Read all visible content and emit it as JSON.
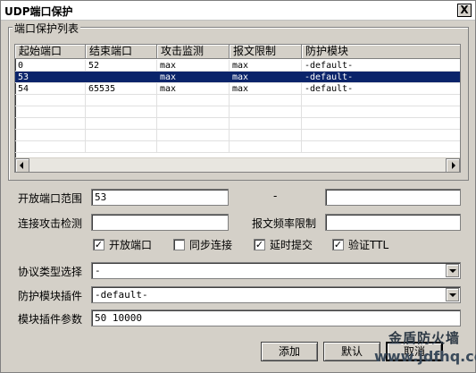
{
  "window": {
    "title": "UDP端口保护",
    "close_label": "X"
  },
  "group": {
    "title": "端口保护列表"
  },
  "table": {
    "columns": [
      "起始端口",
      "结束端口",
      "攻击监测",
      "报文限制",
      "防护模块"
    ],
    "rows": [
      [
        "0",
        "52",
        "max",
        "max",
        "-default-"
      ],
      [
        "53",
        "",
        "max",
        "max",
        "-default-"
      ],
      [
        "54",
        "65535",
        "max",
        "max",
        "-default-"
      ]
    ],
    "selected_row": 1
  },
  "form": {
    "port_range_label": "开放端口范围",
    "port_range_start": "53",
    "port_range_sep": "-",
    "port_range_end": "",
    "attack_detect_label": "连接攻击检测",
    "attack_detect_value": "",
    "packet_rate_label": "报文频率限制",
    "packet_rate_value": "",
    "checkboxes": [
      {
        "label": "开放端口",
        "checked": true
      },
      {
        "label": "同步连接",
        "checked": false
      },
      {
        "label": "延时提交",
        "checked": true
      },
      {
        "label": "验证TTL",
        "checked": true
      }
    ],
    "protocol_label": "协议类型选择",
    "protocol_value": "-",
    "plugin_label": "防护模块插件",
    "plugin_value": "-default-",
    "plugin_params_label": "模块插件参数",
    "plugin_params_value": "50 10000"
  },
  "buttons": {
    "add": "添加",
    "default": "默认",
    "cancel": "取消"
  },
  "watermark": {
    "line1": "金盾防火墙",
    "line2": "www.jdfhq.com"
  }
}
